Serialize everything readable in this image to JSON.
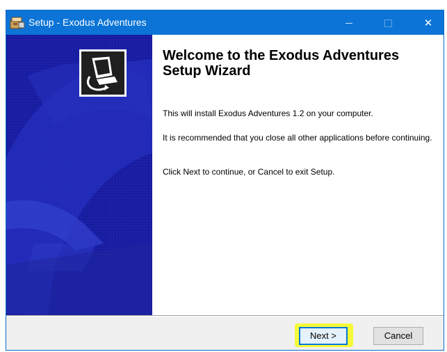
{
  "window": {
    "title": "Setup - Exodus Adventures",
    "controls": {
      "minimize": "minimize",
      "maximize": "maximize",
      "close": "✕"
    },
    "accent_color": "#0b74d6"
  },
  "banner": {
    "background_color": "#1a1e9e",
    "logo_icon": "computer-install-icon"
  },
  "content": {
    "heading": "Welcome to the Exodus Adventures Setup Wizard",
    "paragraphs": [
      "This will install Exodus Adventures 1.2 on your computer.",
      "It is recommended that you close all other applications before continuing.",
      "Click Next to continue, or Cancel to exit Setup."
    ]
  },
  "buttons": {
    "next": "Next >",
    "cancel": "Cancel",
    "next_highlight_color": "#f5fb3a"
  }
}
